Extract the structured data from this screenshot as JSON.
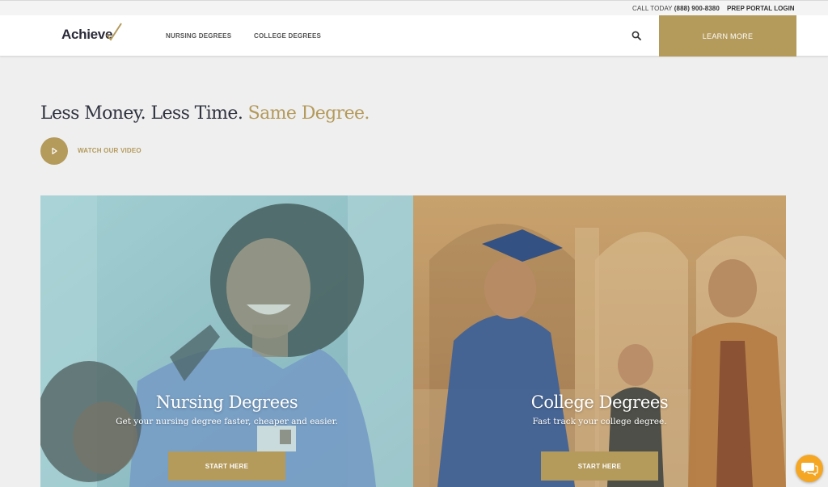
{
  "topbar": {
    "call_prefix": "CALL TODAY",
    "phone": "(888) 900-8380",
    "portal_link": "PREP PORTAL LOGIN"
  },
  "nav": {
    "logo_text": "Achieve",
    "links": [
      "NURSING DEGREES",
      "COLLEGE DEGREES"
    ],
    "search_icon": "search-icon",
    "cta_label": "LEARN MORE"
  },
  "hero": {
    "headline_part1": "Less Money. Less Time.",
    "headline_part2": "Same Degree.",
    "video_label": "WATCH OUR VIDEO"
  },
  "cards": [
    {
      "title": "Nursing Degrees",
      "subtitle": "Get your nursing degree faster, cheaper and easier.",
      "button": "START HERE"
    },
    {
      "title": "College Degrees",
      "subtitle": "Fast track your college degree.",
      "button": "START HERE"
    }
  ],
  "chat": {
    "icon": "chat-bubbles-icon"
  },
  "colors": {
    "gold": "#b49a5b",
    "text_dark": "#2f3240",
    "nursing_tint": "#8fbfc5",
    "college_tint": "#b58f5c",
    "chat_orange": "#f5a623"
  }
}
